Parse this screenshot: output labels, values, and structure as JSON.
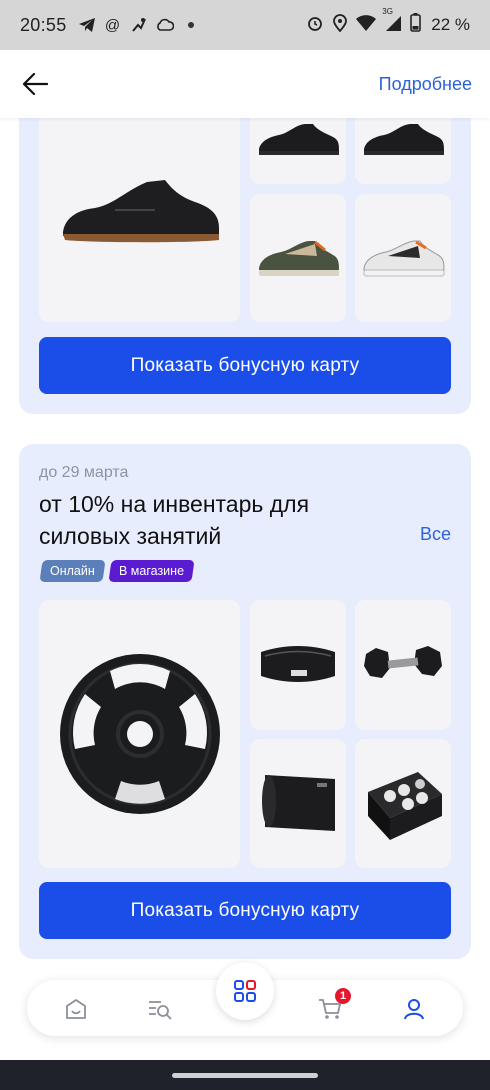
{
  "status_bar": {
    "time": "20:55",
    "network": "3G",
    "battery": "22 %"
  },
  "header": {
    "details_link": "Подробнее"
  },
  "promo_1": {
    "button_label": "Показать бонусную карту"
  },
  "promo_2": {
    "date": "до 29 марта",
    "title": "от 10% на инвентарь для силовых занятий",
    "all_link": "Все",
    "badges": [
      "Онлайн",
      "В магазине"
    ],
    "button_label": "Показать бонусную карту"
  },
  "bottom_nav": {
    "cart_count": "1"
  },
  "colors": {
    "accent": "#1b4ee8",
    "link": "#2a63d8",
    "card_bg": "#e8edfd",
    "badge_online": "#5b7fb8",
    "badge_store": "#5a1bd1",
    "cart_badge": "#e5172f"
  }
}
